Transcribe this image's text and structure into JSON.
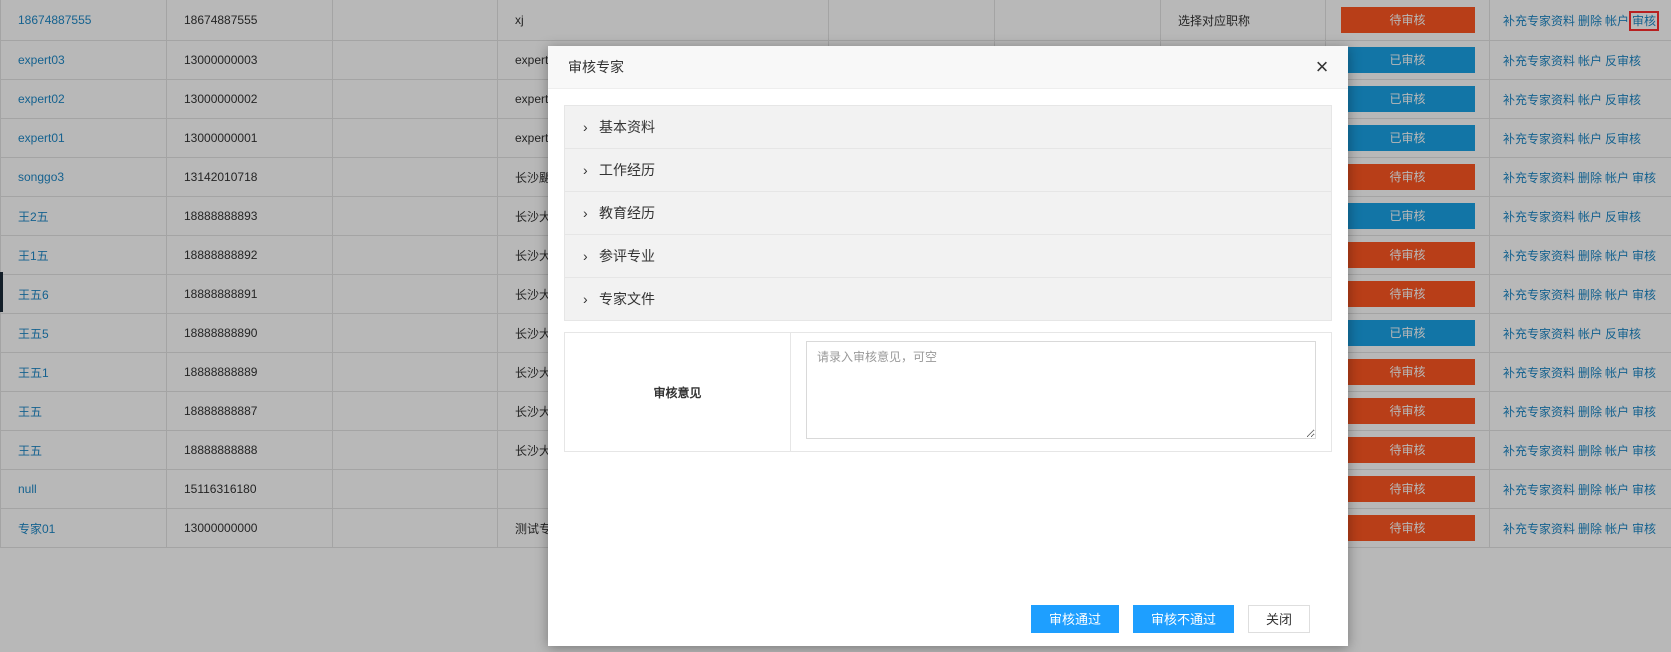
{
  "table": {
    "rows": [
      {
        "name": "18674887555",
        "phone": "18674887555",
        "col3": "",
        "col4": "xj",
        "col5": "",
        "col6": "",
        "col7": "选择对应职称",
        "status": "待审核",
        "status_type": "pending",
        "ops": [
          "补充专家资料",
          "删除",
          "帐户",
          "审核"
        ]
      },
      {
        "name": "expert03",
        "phone": "13000000003",
        "col3": "",
        "col4": "expert",
        "col5": "",
        "col6": "",
        "col7": "",
        "status": "已审核",
        "status_type": "approved",
        "ops": [
          "补充专家资料",
          "帐户",
          "反审核"
        ]
      },
      {
        "name": "expert02",
        "phone": "13000000002",
        "col3": "",
        "col4": "expert",
        "col5": "",
        "col6": "",
        "col7": "",
        "status": "已审核",
        "status_type": "approved",
        "ops": [
          "补充专家资料",
          "帐户",
          "反审核"
        ]
      },
      {
        "name": "expert01",
        "phone": "13000000001",
        "col3": "",
        "col4": "expert",
        "col5": "",
        "col6": "",
        "col7": "",
        "status": "已审核",
        "status_type": "approved",
        "ops": [
          "补充专家资料",
          "帐户",
          "反审核"
        ]
      },
      {
        "name": "songgo3",
        "phone": "13142010718",
        "col3": "",
        "col4": "长沙颶",
        "col5": "",
        "col6": "",
        "col7": "",
        "status": "待审核",
        "status_type": "pending",
        "ops": [
          "补充专家资料",
          "删除",
          "帐户",
          "审核"
        ]
      },
      {
        "name": "王2五",
        "phone": "18888888893",
        "col3": "",
        "col4": "长沙大",
        "col5": "",
        "col6": "",
        "col7": "",
        "status": "已审核",
        "status_type": "approved",
        "ops": [
          "补充专家资料",
          "帐户",
          "反审核"
        ]
      },
      {
        "name": "王1五",
        "phone": "18888888892",
        "col3": "",
        "col4": "长沙大",
        "col5": "",
        "col6": "",
        "col7": "",
        "status": "待审核",
        "status_type": "pending",
        "ops": [
          "补充专家资料",
          "删除",
          "帐户",
          "审核"
        ]
      },
      {
        "name": "王五6",
        "phone": "18888888891",
        "col3": "",
        "col4": "长沙大",
        "col5": "",
        "col6": "",
        "col7": "",
        "status": "待审核",
        "status_type": "pending",
        "ops": [
          "补充专家资料",
          "删除",
          "帐户",
          "审核"
        ]
      },
      {
        "name": "王五5",
        "phone": "18888888890",
        "col3": "",
        "col4": "长沙大",
        "col5": "",
        "col6": "",
        "col7": "",
        "status": "已审核",
        "status_type": "approved",
        "ops": [
          "补充专家资料",
          "帐户",
          "反审核"
        ]
      },
      {
        "name": "王五1",
        "phone": "18888888889",
        "col3": "",
        "col4": "长沙大",
        "col5": "",
        "col6": "",
        "col7": "",
        "status": "待审核",
        "status_type": "pending",
        "ops": [
          "补充专家资料",
          "删除",
          "帐户",
          "审核"
        ]
      },
      {
        "name": "王五",
        "phone": "18888888887",
        "col3": "",
        "col4": "长沙大",
        "col5": "",
        "col6": "",
        "col7": "",
        "status": "待审核",
        "status_type": "pending",
        "ops": [
          "补充专家资料",
          "删除",
          "帐户",
          "审核"
        ]
      },
      {
        "name": "王五",
        "phone": "18888888888",
        "col3": "",
        "col4": "长沙大",
        "col5": "",
        "col6": "",
        "col7": "",
        "status": "待审核",
        "status_type": "pending",
        "ops": [
          "补充专家资料",
          "删除",
          "帐户",
          "审核"
        ]
      },
      {
        "name": "null",
        "phone": "15116316180",
        "col3": "",
        "col4": "",
        "col5": "",
        "col6": "",
        "col7": "",
        "status": "待审核",
        "status_type": "pending",
        "ops": [
          "补充专家资料",
          "删除",
          "帐户",
          "审核"
        ]
      },
      {
        "name": "专家01",
        "phone": "13000000000",
        "col3": "",
        "col4": "测试专",
        "col5": "",
        "col6": "",
        "col7": "",
        "status": "待审核",
        "status_type": "pending",
        "ops": [
          "补充专家资料",
          "删除",
          "帐户",
          "审核"
        ]
      }
    ]
  },
  "dialog": {
    "title": "审核专家",
    "close_icon": "close-icon",
    "sections": [
      "基本资料",
      "工作经历",
      "教育经历",
      "参评专业",
      "专家文件"
    ],
    "opinion_label": "审核意见",
    "opinion_value": "",
    "opinion_placeholder": "请录入审核意见，可空",
    "buttons": {
      "approve": "审核通过",
      "reject": "审核不通过",
      "close": "关闭"
    }
  },
  "colors": {
    "pending": "#ff5722",
    "approved": "#1aa3e6",
    "link": "#1e88c7",
    "primary_button": "#1e9fff"
  }
}
